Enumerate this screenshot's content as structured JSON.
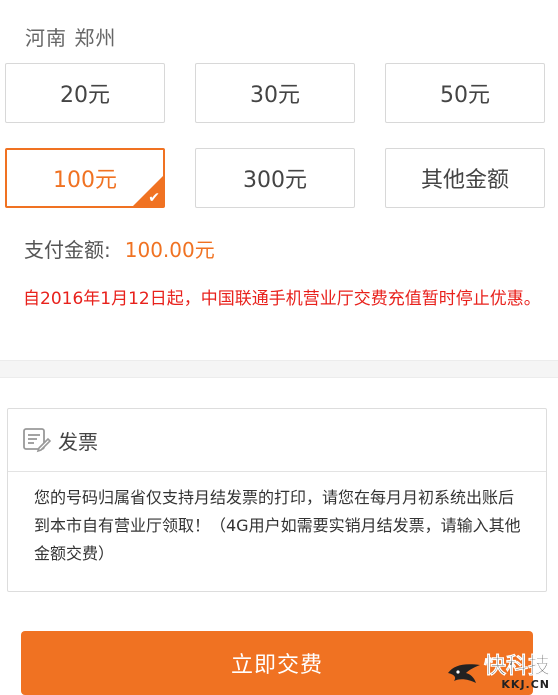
{
  "region": {
    "text": "河南 郑州"
  },
  "amounts": [
    {
      "label": "20元"
    },
    {
      "label": "30元"
    },
    {
      "label": "50元"
    },
    {
      "label": "100元",
      "selected": true
    },
    {
      "label": "300元"
    },
    {
      "label": "其他金额"
    }
  ],
  "payment": {
    "label": "支付金额:",
    "value": "100.00元"
  },
  "notice": {
    "text": "自2016年1月12日起，中国联通手机营业厅交费充值暂时停止优惠。"
  },
  "invoice": {
    "icon": "invoice-edit-icon",
    "title": "发票",
    "body": "您的号码归属省仅支持月结发票的打印，请您在每月月初系统出账后到本市自有营业厅领取！（4G用户如需要实销月结发票，请输入其他金额交费）"
  },
  "submit": {
    "label": "立即交费"
  },
  "watermark": {
    "main": "快科技",
    "sub": "KKJ.CN"
  },
  "colors": {
    "accent": "#f07222",
    "notice": "#e8211c"
  }
}
